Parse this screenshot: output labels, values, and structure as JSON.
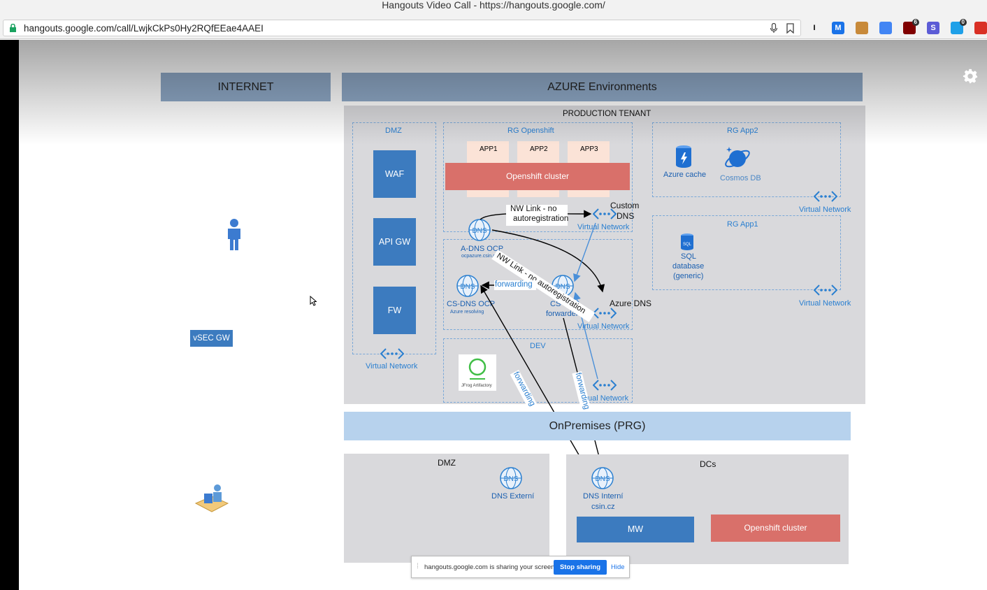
{
  "window": {
    "title": "Hangouts Video Call - https://hangouts.google.com/"
  },
  "browser": {
    "url": "hangouts.google.com/call/LwjkCkPs0Hy2RQfEEae4AAEI",
    "extensions": [
      {
        "name": "instapaper-icon",
        "text": "I",
        "bg": "#f2f2f2",
        "fg": "#000"
      },
      {
        "name": "m-extension-icon",
        "text": "M",
        "bg": "#1a73e8",
        "fg": "#fff"
      },
      {
        "name": "cookie-icon",
        "text": "",
        "bg": "#c88a3a",
        "fg": "#fff"
      },
      {
        "name": "chrome-icon",
        "text": "",
        "bg": "#4285f4",
        "fg": "#fff"
      },
      {
        "name": "ublock-icon",
        "text": "",
        "bg": "#800000",
        "fg": "#fff",
        "badge": "6"
      },
      {
        "name": "s-extension-icon",
        "text": "S",
        "bg": "#5c5cd6",
        "fg": "#fff"
      },
      {
        "name": "notify-icon",
        "text": "",
        "bg": "#1fa0e8",
        "fg": "#fff",
        "badge": "0"
      },
      {
        "name": "alarm-icon",
        "text": "",
        "bg": "#d93025",
        "fg": "#fff"
      }
    ]
  },
  "diagram": {
    "internet_header": "INTERNET",
    "azure_header": "AZURE Environments",
    "production_tenant": "PRODUCTION TENANT",
    "dmz": "DMZ",
    "waf": "WAF",
    "api_gw": "API GW",
    "fw": "FW",
    "virtual_network": "Virtual Network",
    "rg_openshift": "RG Openshift",
    "app1": "APP1",
    "app2": "APP2",
    "app3": "APP3",
    "openshift_cluster": "Openshift cluster",
    "rg_app2": "RG App2",
    "azure_cache": "Azure cache",
    "cosmos_db": "Cosmos DB",
    "rg_app1": "RG App1",
    "sql_line1": "SQL",
    "sql_line2": "database",
    "sql_line3": "(generic)",
    "nw_link_1a": "NW Link  - no",
    "nw_link_1b": "autoregistration",
    "nw_link_2": "NW Link  - no autoregistration",
    "custom_dns_a": "Custom",
    "custom_dns_b": "DNS",
    "a_dns_ocp": "A-DNS OCP",
    "a_dns_sub": "ocpazure.csin.cz",
    "cs_dns_ocp": "CS-DNS OCP",
    "cs_dns_ocp_sub": "Azure resolving",
    "forwarding": "forwarding",
    "cs_dns_fwd_a": "CS-DNS",
    "cs_dns_fwd_b": "forwarder",
    "azure_dns": "Azure DNS",
    "dev": "DEV",
    "jfrog": "JFrog Artifactory",
    "vsec_gw": "vSEC GW",
    "on_premises": "OnPremises (PRG)",
    "dmz_onprem": "DMZ",
    "dns_externi": "DNS Externí",
    "dcs": "DCs",
    "dns_interni_a": "DNS Interní",
    "dns_interni_b": "csin.cz",
    "mw": "MW",
    "openshift_cluster_2": "Openshift cluster",
    "ual_network": "ual Network"
  },
  "share_bar": {
    "text": "hangouts.google.com is sharing your screen.",
    "stop_label": "Stop sharing",
    "hide_label": "Hide"
  },
  "colors": {
    "header": "#8fa9c7",
    "tenant_bg": "#d9d9dc",
    "blue_box": "#3c7bbf",
    "red_box": "#d9706a",
    "light_blue": "#b7d2ed",
    "link_blue": "#2a7fd0"
  }
}
